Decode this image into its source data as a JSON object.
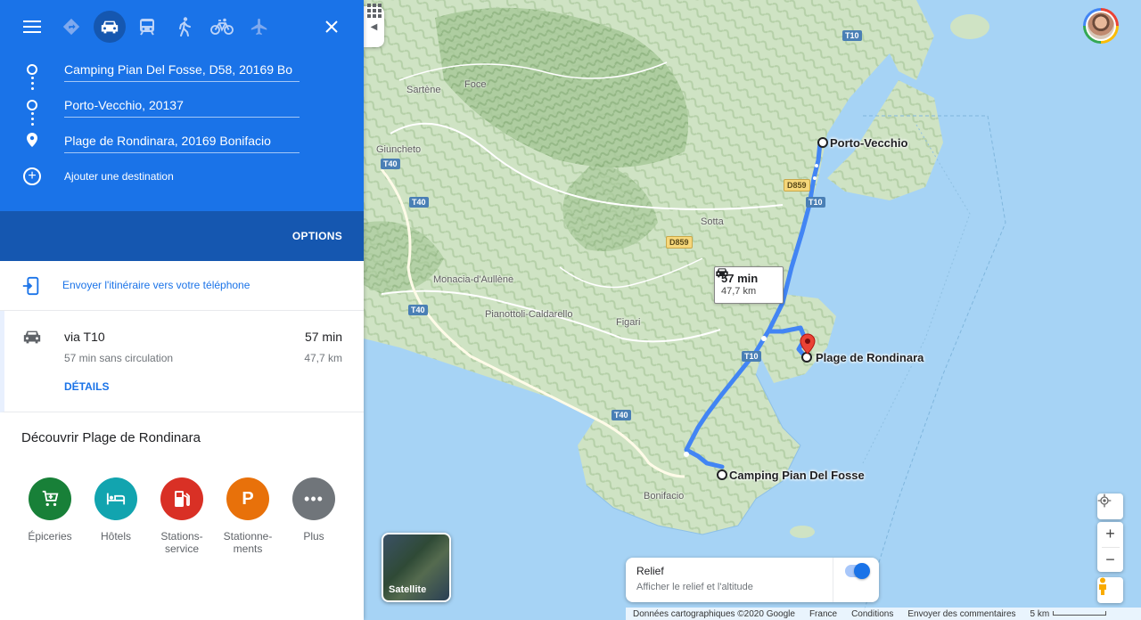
{
  "app": "Google Maps",
  "header": {
    "modes": [
      "best-route",
      "driving",
      "transit",
      "walking",
      "cycling",
      "flight"
    ],
    "active_mode": "driving",
    "waypoints": [
      {
        "value": "Camping Pian Del Fosse, D58, 20169 Bo",
        "kind": "stop"
      },
      {
        "value": "Porto-Vecchio, 20137",
        "kind": "stop"
      },
      {
        "value": "Plage de Rondinara, 20169 Bonifacio",
        "kind": "destination"
      }
    ],
    "add_destination": "Ajouter une destination",
    "options_label": "OPTIONS"
  },
  "send_to_phone": "Envoyer l'itinéraire vers votre téléphone",
  "route": {
    "via": "via T10",
    "time": "57 min",
    "traffic_note": "57 min sans circulation",
    "distance": "47,7 km",
    "details_label": "DÉTAILS"
  },
  "discover": {
    "title": "Découvrir Plage de Rondinara",
    "categories": [
      {
        "label": "Épiceries",
        "color": "#188038",
        "icon": "cart-icon"
      },
      {
        "label": "Hôtels",
        "color": "#12a4af",
        "icon": "bed-icon"
      },
      {
        "label": "Stations-\nservice",
        "color": "#d93025",
        "icon": "fuel-icon"
      },
      {
        "label": "Stationne-\nments",
        "color": "#e8710a",
        "icon": "parking-icon"
      },
      {
        "label": "Plus",
        "color": "#70757a",
        "icon": "more-icon"
      }
    ]
  },
  "map": {
    "route_bubble": {
      "time": "57 min",
      "distance": "47,7 km"
    },
    "places": {
      "porto_vecchio": "Porto-Vecchio",
      "rondinara": "Plage de Rondinara",
      "camping": "Camping Pian Del Fosse"
    },
    "towns": {
      "sartene": "Sartène",
      "foce": "Foce",
      "giuncheto": "Giuncheto",
      "sotta": "Sotta",
      "monacia": "Monacia-d'Aullène",
      "pianottoli": "Pianottoli-Caldarello",
      "figari": "Figari",
      "bonifacio": "Bonifacio"
    },
    "roads": {
      "t10": "T10",
      "t40": "T40",
      "d859": "D859"
    },
    "satellite_label": "Satellite",
    "relief": {
      "title": "Relief",
      "subtitle": "Afficher le relief et l'altitude",
      "enabled": true
    },
    "footer": {
      "data": "Données cartographiques ©2020 Google",
      "country": "France",
      "terms": "Conditions",
      "feedback": "Envoyer des commentaires",
      "scale": "5 km"
    },
    "zoom_in": "+",
    "zoom_out": "−",
    "route_color": "#4285f4",
    "water_color": "#a6d3f5",
    "land_color": "#d7e8cf"
  }
}
